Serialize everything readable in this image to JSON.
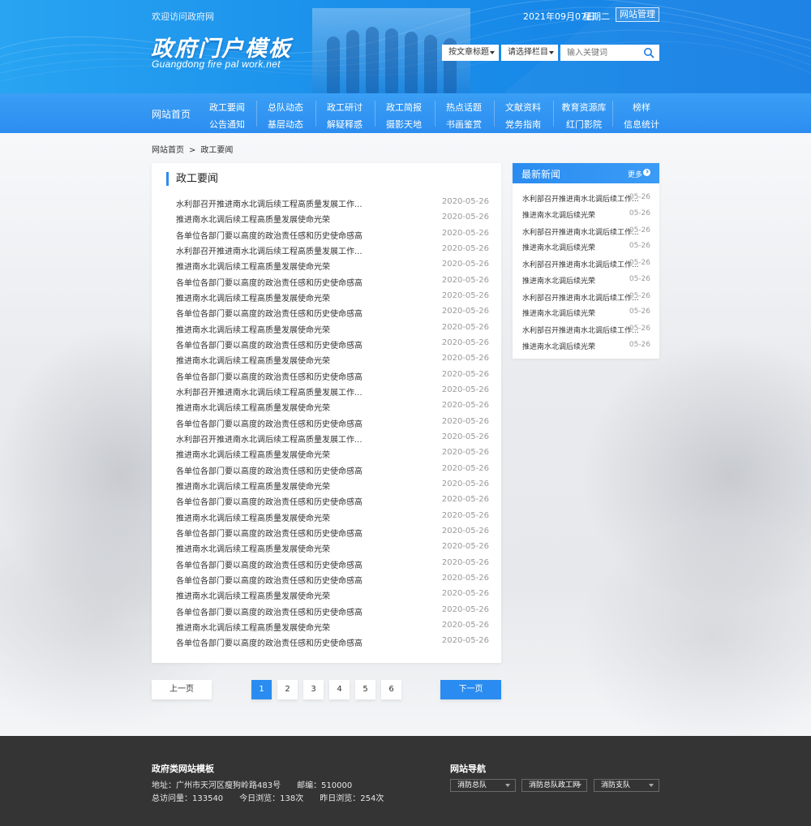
{
  "header": {
    "welcome": "欢迎访问政府网",
    "date": "2021年09月07日",
    "weekday": "星期二",
    "admin_label": "网站管理",
    "site_title": "政府门户模板",
    "site_subtitle": "Guangdong fire pal work.net",
    "search_type": "按文章标题",
    "search_column": "请选择栏目",
    "search_placeholder": "输入关键词"
  },
  "nav": {
    "home": "网站首页",
    "columns": [
      {
        "top": "政工要闻",
        "bottom": "公告通知"
      },
      {
        "top": "总队动态",
        "bottom": "基层动态"
      },
      {
        "top": "政工研讨",
        "bottom": "解疑释惑"
      },
      {
        "top": "政工简报",
        "bottom": "摄影天地"
      },
      {
        "top": "热点话题",
        "bottom": "书画鉴赏"
      },
      {
        "top": "文献资料",
        "bottom": "党务指南"
      },
      {
        "top": "教育资源库",
        "bottom": "红门影院"
      },
      {
        "top": "榜样",
        "bottom": "信息统计"
      }
    ]
  },
  "breadcrumb": {
    "home": "网站首页",
    "sep": ">",
    "current": "政工要闻"
  },
  "list": {
    "title": "政工要闻",
    "items": [
      {
        "title": "水利部召开推进南水北调后续工程高质量发展工作...",
        "date": "2020-05-26"
      },
      {
        "title": "推进南水北调后续工程高质量发展使命光荣",
        "date": "2020-05-26"
      },
      {
        "title": "各单位各部门要以高度的政治责任感和历史使命感高",
        "date": "2020-05-26"
      },
      {
        "title": "水利部召开推进南水北调后续工程高质量发展工作...",
        "date": "2020-05-26"
      },
      {
        "title": "推进南水北调后续工程高质量发展使命光荣",
        "date": "2020-05-26"
      },
      {
        "title": "各单位各部门要以高度的政治责任感和历史使命感高",
        "date": "2020-05-26"
      },
      {
        "title": "推进南水北调后续工程高质量发展使命光荣",
        "date": "2020-05-26"
      },
      {
        "title": "各单位各部门要以高度的政治责任感和历史使命感高",
        "date": "2020-05-26"
      },
      {
        "title": "推进南水北调后续工程高质量发展使命光荣",
        "date": "2020-05-26"
      },
      {
        "title": "各单位各部门要以高度的政治责任感和历史使命感高",
        "date": "2020-05-26"
      },
      {
        "title": "推进南水北调后续工程高质量发展使命光荣",
        "date": "2020-05-26"
      },
      {
        "title": "各单位各部门要以高度的政治责任感和历史使命感高",
        "date": "2020-05-26"
      },
      {
        "title": "水利部召开推进南水北调后续工程高质量发展工作...",
        "date": "2020-05-26"
      },
      {
        "title": "推进南水北调后续工程高质量发展使命光荣",
        "date": "2020-05-26"
      },
      {
        "title": "各单位各部门要以高度的政治责任感和历史使命感高",
        "date": "2020-05-26"
      },
      {
        "title": "水利部召开推进南水北调后续工程高质量发展工作...",
        "date": "2020-05-26"
      },
      {
        "title": "推进南水北调后续工程高质量发展使命光荣",
        "date": "2020-05-26"
      },
      {
        "title": "各单位各部门要以高度的政治责任感和历史使命感高",
        "date": "2020-05-26"
      },
      {
        "title": "推进南水北调后续工程高质量发展使命光荣",
        "date": "2020-05-26"
      },
      {
        "title": "各单位各部门要以高度的政治责任感和历史使命感高",
        "date": "2020-05-26"
      },
      {
        "title": "推进南水北调后续工程高质量发展使命光荣",
        "date": "2020-05-26"
      },
      {
        "title": "各单位各部门要以高度的政治责任感和历史使命感高",
        "date": "2020-05-26"
      },
      {
        "title": "推进南水北调后续工程高质量发展使命光荣",
        "date": "2020-05-26"
      },
      {
        "title": "各单位各部门要以高度的政治责任感和历史使命感高",
        "date": "2020-05-26"
      },
      {
        "title": "各单位各部门要以高度的政治责任感和历史使命感高",
        "date": "2020-05-26"
      },
      {
        "title": "推进南水北调后续工程高质量发展使命光荣",
        "date": "2020-05-26"
      },
      {
        "title": "各单位各部门要以高度的政治责任感和历史使命感高",
        "date": "2020-05-26"
      },
      {
        "title": "推进南水北调后续工程高质量发展使命光荣",
        "date": "2020-05-26"
      },
      {
        "title": "各单位各部门要以高度的政治责任感和历史使命感高",
        "date": "2020-05-26"
      }
    ]
  },
  "latest": {
    "title": "最新新闻",
    "more": "更多",
    "items": [
      {
        "title": "水利部召开推进南水北调后续工作...",
        "date": "05-26"
      },
      {
        "title": "推进南水北调后续光荣",
        "date": "05-26"
      },
      {
        "title": "水利部召开推进南水北调后续工作...",
        "date": "05-26"
      },
      {
        "title": "推进南水北调后续光荣",
        "date": "05-26"
      },
      {
        "title": "水利部召开推进南水北调后续工作...",
        "date": "05-26"
      },
      {
        "title": "推进南水北调后续光荣",
        "date": "05-26"
      },
      {
        "title": "水利部召开推进南水北调后续工作...",
        "date": "05-26"
      },
      {
        "title": "推进南水北调后续光荣",
        "date": "05-26"
      },
      {
        "title": "水利部召开推进南水北调后续工作...",
        "date": "05-26"
      },
      {
        "title": "推进南水北调后续光荣",
        "date": "05-26"
      }
    ]
  },
  "pagination": {
    "prev": "上一页",
    "next": "下一页",
    "pages": [
      "1",
      "2",
      "3",
      "4",
      "5",
      "6"
    ],
    "current": "1"
  },
  "footer": {
    "title": "政府类网站模板",
    "address": "地址：广州市天河区瘦狗岭路483号　　邮编：510000",
    "stats": "总访问量：133540　　今日浏览：138次　　昨日浏览：254次",
    "nav_title": "网站导航",
    "nav_selects": [
      "消防总队",
      "消防总队政工网",
      "消防支队"
    ]
  },
  "colors": {
    "header_blue": "#1a8fea",
    "nav_blue": "#2c8df0",
    "accent": "#2a8cf0",
    "footer_bg": "#343434"
  }
}
